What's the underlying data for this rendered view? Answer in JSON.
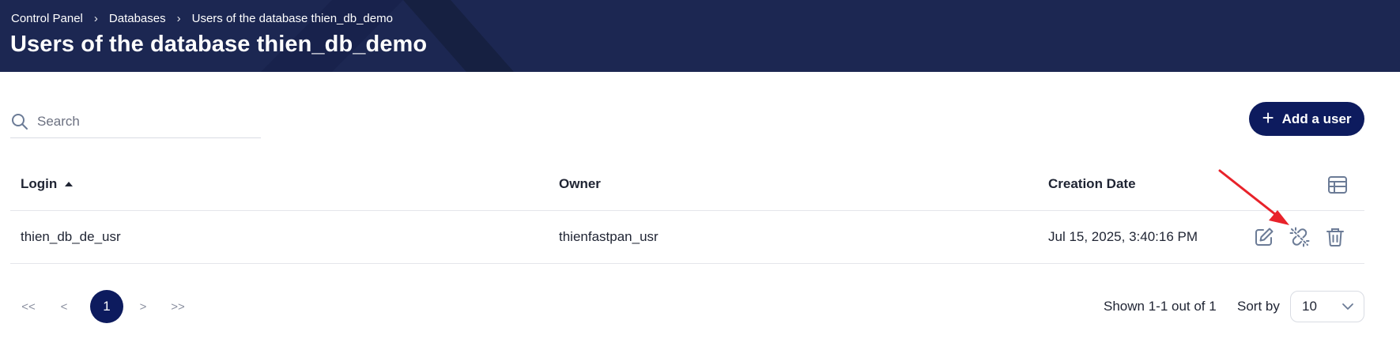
{
  "header": {
    "breadcrumb": [
      "Control Panel",
      "Databases",
      "Users of the database thien_db_demo"
    ],
    "title": "Users of the database thien_db_demo"
  },
  "search": {
    "placeholder": "Search",
    "value": ""
  },
  "toolbar": {
    "add_label": "Add a user"
  },
  "table": {
    "columns": [
      "Login",
      "Owner",
      "Creation Date"
    ],
    "sort": {
      "column": "Login",
      "direction": "ascending"
    },
    "rows": [
      {
        "login": "thien_db_de_usr",
        "owner": "thienfastpan_usr",
        "created": "Jul 15, 2025, 3:40:16 PM"
      }
    ]
  },
  "pagination": {
    "first": "<<",
    "prev": "<",
    "current": "1",
    "next": ">",
    "last": ">>",
    "shown": "Shown 1-1 out of 1",
    "sort_label": "Sort by",
    "per_page": "10"
  },
  "colors": {
    "header_bg": "#1c2752",
    "accent": "#0d1b5e",
    "annotation": "#e8222a",
    "icon": "#6b7b96"
  }
}
